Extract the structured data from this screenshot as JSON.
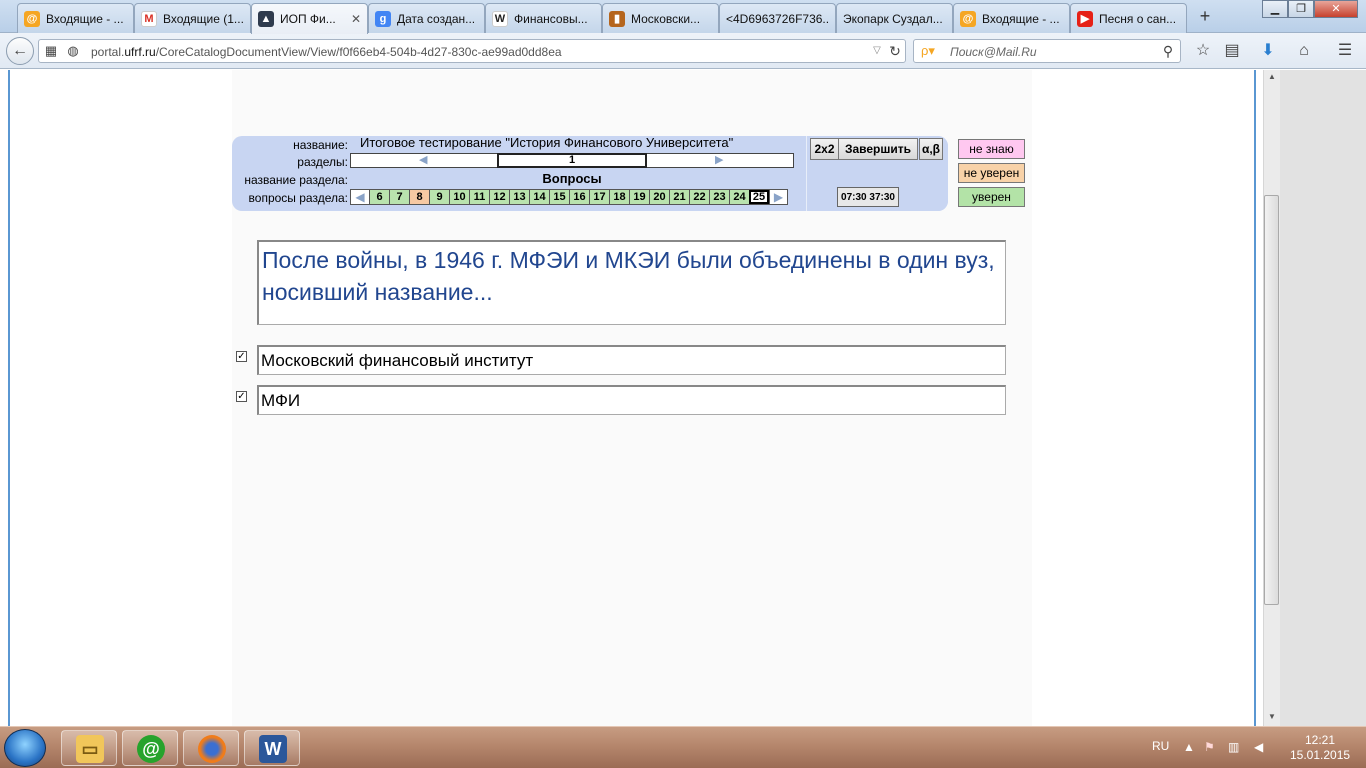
{
  "tabs": [
    {
      "label": "Входящие - ...",
      "icon": "mail-ru-icon",
      "color": "#f5a623"
    },
    {
      "label": "Входящие (1...",
      "icon": "gmail-icon",
      "color": "#d93025"
    },
    {
      "label": "ИОП Фи...",
      "icon": "graduation-cap-icon",
      "color": "#2f3b4d",
      "active": true
    },
    {
      "label": "Дата создан...",
      "icon": "google-icon",
      "color": "#4285f4"
    },
    {
      "label": "Финансовы...",
      "icon": "wikipedia-icon",
      "color": "#666666"
    },
    {
      "label": "Московски...",
      "icon": "books-icon",
      "color": "#b5651d"
    },
    {
      "label": "<4D6963726F736...",
      "icon": "",
      "color": ""
    },
    {
      "label": "Экопарк Суздал...",
      "icon": "",
      "color": ""
    },
    {
      "label": "Входящие - ...",
      "icon": "mail-ru-icon",
      "color": "#f5a623"
    },
    {
      "label": "Песня о сан...",
      "icon": "youtube-icon",
      "color": "#e62117"
    }
  ],
  "nav": {
    "url_prefix": "portal.",
    "url_domain": "ufrf.ru",
    "url_path": "/CoreCatalogDocumentView/View/f0f66eb4-504b-4d27-830c-ae99ad0dd8ea",
    "search_placeholder": "Поиск@Mail.Ru"
  },
  "test": {
    "name_label": "название:",
    "name_value": "Итоговое тестирование \"История Финансового Университета\"",
    "sections_label": "разделы:",
    "current_section": "1",
    "section_name_label": "название раздела:",
    "section_name": "Вопросы",
    "questions_label": "вопросы раздела:",
    "question_numbers": [
      "6",
      "7",
      "8",
      "9",
      "10",
      "11",
      "12",
      "13",
      "14",
      "15",
      "16",
      "17",
      "18",
      "19",
      "20",
      "21",
      "22",
      "23",
      "24",
      "25"
    ],
    "question_states": [
      "green",
      "green",
      "orange",
      "green",
      "green",
      "green",
      "green",
      "green",
      "green",
      "green",
      "green",
      "green",
      "green",
      "green",
      "green",
      "green",
      "green",
      "green",
      "green",
      "current"
    ],
    "btn_2x2": "2x2",
    "btn_finish": "Завершить",
    "btn_alpha": "α,β",
    "timer": "07:30  37:30"
  },
  "confidence": {
    "dont_know": "не знаю",
    "not_sure": "не уверен",
    "sure": "уверен",
    "colors": {
      "dont_know": "#ffc8f0",
      "not_sure": "#f8d2a8",
      "sure": "#b3e3a7"
    }
  },
  "question": {
    "text": " После войны, в 1946 г. МФЭИ и МКЭИ были объединены в один вуз, носивший название..."
  },
  "answers": [
    {
      "text": "Московский финансовый институт",
      "checked": true
    },
    {
      "text": "МФИ",
      "checked": true
    }
  ],
  "taskbar": {
    "lang": "RU",
    "time": "12:21",
    "date": "15.01.2015"
  }
}
